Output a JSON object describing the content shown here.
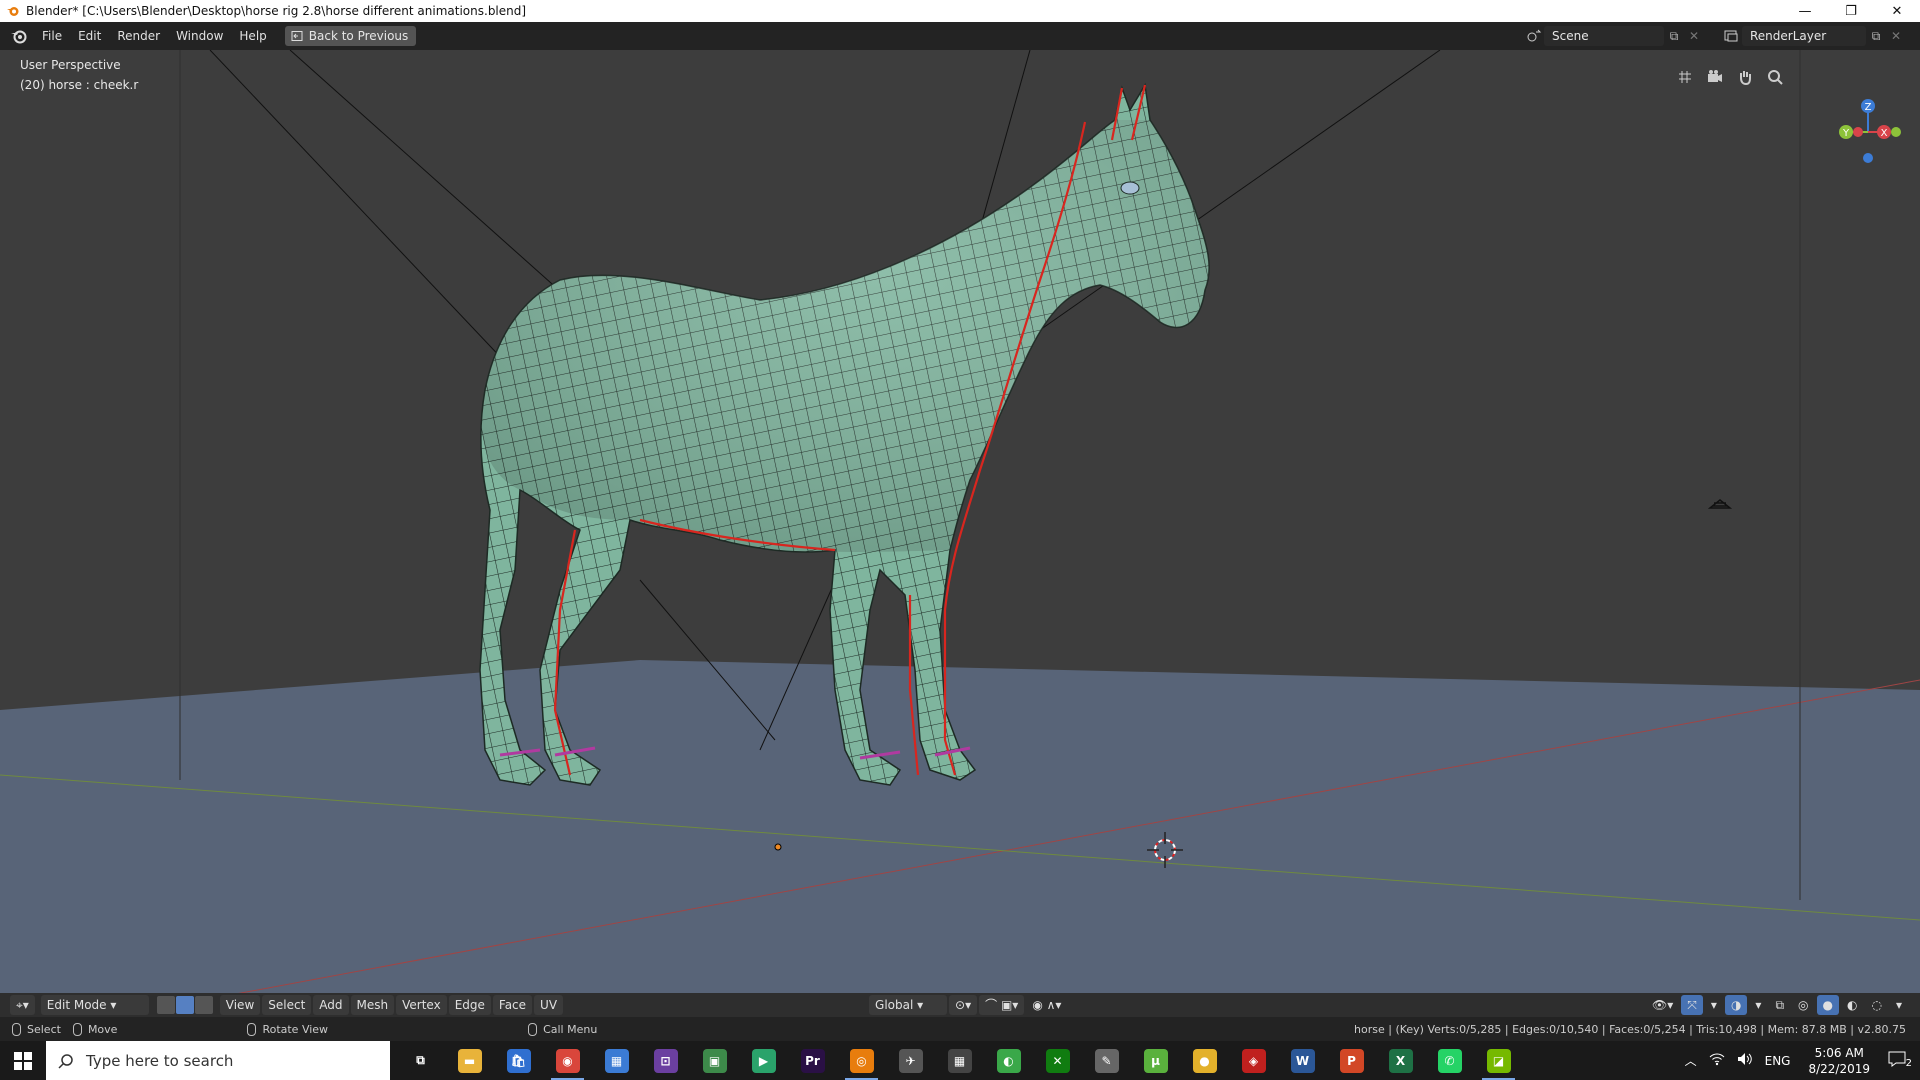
{
  "window": {
    "title": "Blender* [C:\\Users\\Blender\\Desktop\\horse rig 2.8\\horse different animations.blend]",
    "minimize": "—",
    "restore": "❐",
    "close": "✕"
  },
  "topbar": {
    "menus": [
      "File",
      "Edit",
      "Render",
      "Window",
      "Help"
    ],
    "back_label": "Back to Previous",
    "scene_label": "Scene",
    "renderlayer_label": "RenderLayer"
  },
  "viewport": {
    "perspective_label": "User Perspective",
    "object_label": "(20) horse : cheek.r",
    "gizmo": {
      "z": "Z",
      "x": "X",
      "y": "Y"
    },
    "colors": {
      "background": "#3d3d3d",
      "floor": "#586478",
      "mesh_fill": "#7fb59e",
      "mesh_wire": "#1d2a24",
      "seam": "#d8261f",
      "x_axis": "#a04545",
      "y_axis": "#6f8a3f"
    }
  },
  "view_header": {
    "mode": "Edit Mode",
    "menus": [
      "View",
      "Select",
      "Add",
      "Mesh",
      "Vertex",
      "Edge",
      "Face",
      "UV"
    ],
    "orientation": "Global"
  },
  "statusbar": {
    "select": "Select",
    "move": "Move",
    "rotate": "Rotate View",
    "call_menu": "Call Menu",
    "stats": "horse | (Key) Verts:0/5,285 | Edges:0/10,540 | Faces:0/5,254 | Tris:10,498 | Mem: 87.8 MB | v2.80.75"
  },
  "taskbar": {
    "search_placeholder": "Type here to search",
    "apps": [
      {
        "name": "task-view",
        "glyph": "⧉",
        "color": "#1a1a1a"
      },
      {
        "name": "file-explorer",
        "glyph": "▬",
        "color": "#e8b33a"
      },
      {
        "name": "store",
        "glyph": "🛍",
        "color": "#2f6fd0"
      },
      {
        "name": "chrome",
        "glyph": "◉",
        "color": "#d9463b"
      },
      {
        "name": "calendar-app",
        "glyph": "▦",
        "color": "#3b7bd4"
      },
      {
        "name": "app-purple",
        "glyph": "⊡",
        "color": "#6b3fa0"
      },
      {
        "name": "photos",
        "glyph": "▣",
        "color": "#3d8a4a"
      },
      {
        "name": "media-app",
        "glyph": "▶",
        "color": "#2aa36b"
      },
      {
        "name": "premiere",
        "glyph": "Pr",
        "color": "#2a1045"
      },
      {
        "name": "blender",
        "glyph": "◎",
        "color": "#e87d0d"
      },
      {
        "name": "tool-app",
        "glyph": "✈",
        "color": "#555555"
      },
      {
        "name": "calculator",
        "glyph": "▦",
        "color": "#444444"
      },
      {
        "name": "app-green",
        "glyph": "◐",
        "color": "#3aa849"
      },
      {
        "name": "xbox",
        "glyph": "✕",
        "color": "#107c10"
      },
      {
        "name": "pen-app",
        "glyph": "✎",
        "color": "#666666"
      },
      {
        "name": "utorrent",
        "glyph": "µ",
        "color": "#5ab13d"
      },
      {
        "name": "coin-app",
        "glyph": "●",
        "color": "#e3b12b"
      },
      {
        "name": "media-red",
        "glyph": "◈",
        "color": "#c0201e"
      },
      {
        "name": "word",
        "glyph": "W",
        "color": "#2b5797"
      },
      {
        "name": "powerpoint",
        "glyph": "P",
        "color": "#d24726"
      },
      {
        "name": "excel",
        "glyph": "X",
        "color": "#1e7145"
      },
      {
        "name": "whatsapp",
        "glyph": "✆",
        "color": "#25d366"
      },
      {
        "name": "nvidia",
        "glyph": "◪",
        "color": "#76b900"
      }
    ],
    "language": "ENG",
    "time": "5:06 AM",
    "date": "8/22/2019",
    "notifications": "2"
  }
}
